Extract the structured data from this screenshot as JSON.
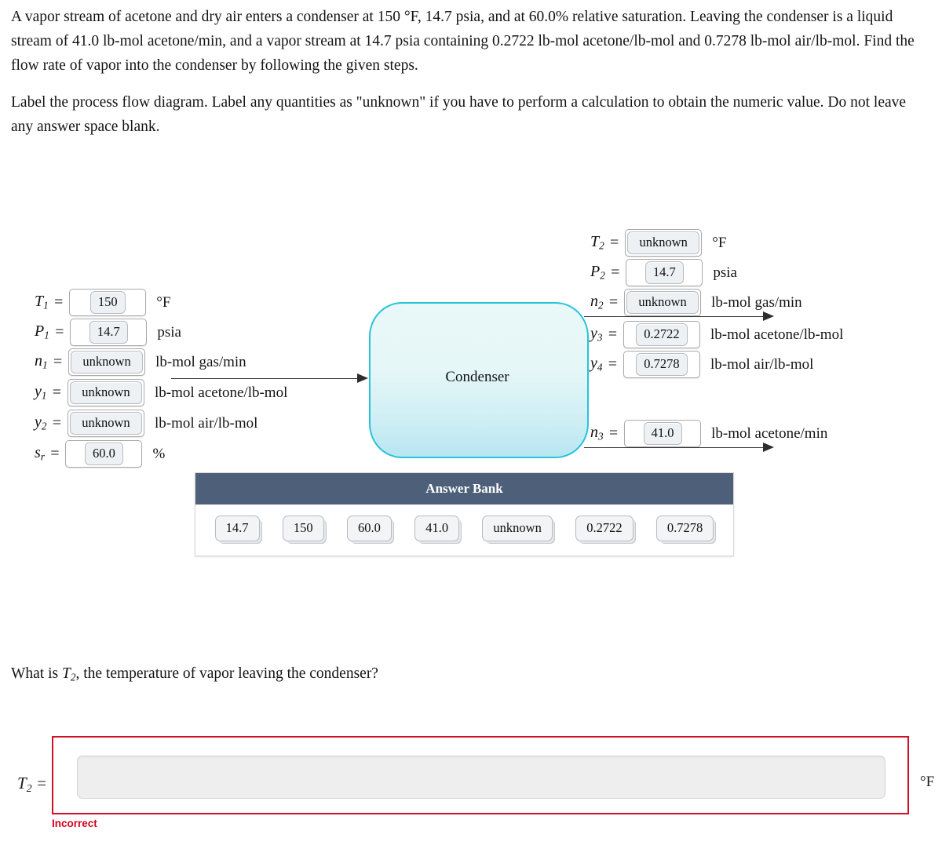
{
  "problem": {
    "paragraph1": "A vapor stream of acetone and dry air enters a condenser at 150 °F, 14.7 psia, and at 60.0% relative saturation. Leaving the condenser is a liquid stream of 41.0 lb-mol acetone/min, and a vapor stream at 14.7 psia containing 0.2722 lb-mol acetone/lb-mol and 0.7278 lb-mol air/lb-mol. Find the flow rate of vapor into the condenser by following the given steps.",
    "paragraph2": "Label the process flow diagram. Label any quantities as \"unknown\" if you have to perform a calculation to obtain the numeric value. Do not leave any answer space blank."
  },
  "diagram": {
    "unit_label": "Condenser",
    "inlet": [
      {
        "symbol": "T",
        "subscript": "1",
        "equals": "=",
        "value": "150",
        "unit": "°F",
        "filled": false
      },
      {
        "symbol": "P",
        "subscript": "1",
        "equals": "=",
        "value": "14.7",
        "unit": "psia",
        "filled": false
      },
      {
        "symbol": "n",
        "subscript": "1",
        "equals": "=",
        "value": "unknown",
        "unit": "lb-mol gas/min",
        "filled": true
      },
      {
        "symbol": "y",
        "subscript": "1",
        "equals": "=",
        "value": "unknown",
        "unit": "lb-mol acetone/lb-mol",
        "filled": true
      },
      {
        "symbol": "y",
        "subscript": "2",
        "equals": "=",
        "value": "unknown",
        "unit": "lb-mol air/lb-mol",
        "filled": true
      },
      {
        "symbol": "s",
        "subscript": "r",
        "equals": "=",
        "value": "60.0",
        "unit": "%",
        "filled": false
      }
    ],
    "vapor_outlet": [
      {
        "symbol": "T",
        "subscript": "2",
        "equals": "=",
        "value": "unknown",
        "unit": "°F",
        "filled": true
      },
      {
        "symbol": "P",
        "subscript": "2",
        "equals": "=",
        "value": "14.7",
        "unit": "psia",
        "filled": false
      },
      {
        "symbol": "n",
        "subscript": "2",
        "equals": "=",
        "value": "unknown",
        "unit": "lb-mol gas/min",
        "filled": true
      },
      {
        "symbol": "y",
        "subscript": "3",
        "equals": "=",
        "value": "0.2722",
        "unit": "lb-mol acetone/lb-mol",
        "filled": false
      },
      {
        "symbol": "y",
        "subscript": "4",
        "equals": "=",
        "value": "0.7278",
        "unit": "lb-mol air/lb-mol",
        "filled": false
      }
    ],
    "liquid_outlet": [
      {
        "symbol": "n",
        "subscript": "3",
        "equals": "=",
        "value": "41.0",
        "unit": "lb-mol acetone/min",
        "filled": false
      }
    ]
  },
  "answer_bank": {
    "title": "Answer Bank",
    "tiles": [
      "14.7",
      "150",
      "60.0",
      "41.0",
      "unknown",
      "0.2722",
      "0.7278"
    ]
  },
  "question": {
    "prefix": "What is ",
    "symbol": "T",
    "subscript": "2",
    "suffix": ", the temperature of vapor leaving the condenser?"
  },
  "answer": {
    "label_symbol": "T",
    "label_subscript": "2",
    "label_equals": "=",
    "value": "",
    "placeholder": "",
    "unit": "°F",
    "status": "Incorrect"
  },
  "colors": {
    "vessel_border": "#27c3da",
    "vessel_fill_top": "#e9f8f8",
    "vessel_fill_bottom": "#b8e6f1",
    "bank_header": "#4e6079",
    "error_border": "#cf1126",
    "error_text": "#d0021b"
  }
}
